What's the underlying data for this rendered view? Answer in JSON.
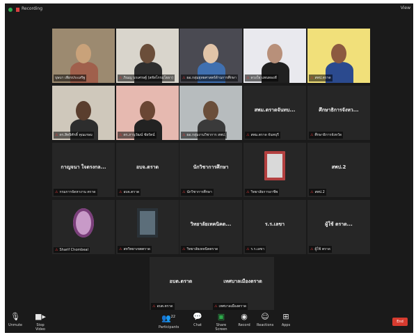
{
  "topbar": {
    "recording_label": "Recording",
    "view_label": "View"
  },
  "participants": [
    {
      "label": "บุษบา เพียรประเสริฐ",
      "bigname": "",
      "video": true,
      "muted": false,
      "active": true
    },
    {
      "label": "ภิณญ นรเศรษฐ์ (สหัสโกรมโยธา)",
      "bigname": "",
      "video": true,
      "muted": true,
      "active": false
    },
    {
      "label": "ผอ.กลุ่มยุทธศาสตร์ด้านการศึกษา",
      "bigname": "",
      "video": true,
      "muted": true,
      "active": false
    },
    {
      "label": "ดวงใจ แพนทองดี",
      "bigname": "",
      "video": true,
      "muted": true,
      "active": false
    },
    {
      "label": "สพป.ตราด",
      "bigname": "",
      "video": true,
      "muted": true,
      "active": false
    },
    {
      "label": "ดร.สิทธิศักดิ์ คุณเกษม",
      "bigname": "",
      "video": true,
      "muted": true,
      "active": false
    },
    {
      "label": "ดร.ภานุวัฒน์ ชัยรัตน์",
      "bigname": "",
      "video": true,
      "muted": true,
      "active": false
    },
    {
      "label": "ผอ.กลุ่มงานวิชาการ สพป.",
      "bigname": "",
      "video": true,
      "muted": true,
      "active": false
    },
    {
      "label": "สพม.ตราด จันทบุรี",
      "bigname": "สพม.ตราดจันทบ...",
      "video": false,
      "muted": true,
      "active": false
    },
    {
      "label": "ศึกษาธิการจังหวัด",
      "bigname": "ศึกษาธิการจังหว...",
      "video": false,
      "muted": true,
      "active": false
    },
    {
      "label": "กรมการจัดหางาน ตราด",
      "bigname": "กาญจนา ใจตรงกล...",
      "video": false,
      "muted": true,
      "active": false
    },
    {
      "label": "อบจ.ตราด",
      "bigname": "อบจ.ตราด",
      "video": false,
      "muted": true,
      "active": false
    },
    {
      "label": "นักวิชาการศึกษา",
      "bigname": "นักวิชาการศึกษา",
      "video": false,
      "muted": true,
      "active": false
    },
    {
      "label": "วิทยาลัยการอาชีพ",
      "bigname": "",
      "video": true,
      "muted": true,
      "active": false
    },
    {
      "label": "สพป.2",
      "bigname": "สพป.2",
      "video": false,
      "muted": true,
      "active": false
    },
    {
      "label": "Sharif Chombeal",
      "bigname": "",
      "video": true,
      "muted": true,
      "active": false
    },
    {
      "label": "สหวิทยาเขตตราด",
      "bigname": "",
      "video": true,
      "muted": true,
      "active": false
    },
    {
      "label": "วิทยาลัยเทคนิคตราด",
      "bigname": "วิทยาลัยเทคนิคต...",
      "video": false,
      "muted": true,
      "active": false
    },
    {
      "label": "ร.ร.เลขา",
      "bigname": "ร.ร.เลขา",
      "video": false,
      "muted": true,
      "active": false
    },
    {
      "label": "ผู้ใช้ ตราด",
      "bigname": "ผู้ใช้ ตราด...",
      "video": false,
      "muted": true,
      "active": false
    },
    {
      "label": "อบต.ตราด",
      "bigname": "อบต.ตราด",
      "video": false,
      "muted": true,
      "active": false
    },
    {
      "label": "เทศบาลเมืองตราด",
      "bigname": "เทศบาลเมืองตราด",
      "video": false,
      "muted": true,
      "active": false
    }
  ],
  "toolbar": {
    "unmute": {
      "label": "Unmute",
      "icon": "microphone-icon"
    },
    "start_video": {
      "label": "Stop Video",
      "icon": "video-camera-icon"
    },
    "participants": {
      "label": "Participants",
      "icon": "participants-icon",
      "count": "22"
    },
    "chat": {
      "label": "Chat",
      "icon": "chat-icon"
    },
    "share_screen": {
      "label": "Share Screen",
      "icon": "share-screen-icon",
      "color": "#2da94a"
    },
    "record": {
      "label": "Record",
      "icon": "record-icon"
    },
    "reactions": {
      "label": "Reactions",
      "icon": "reactions-icon"
    },
    "apps": {
      "label": "Apps",
      "icon": "apps-icon"
    },
    "end": {
      "label": "End",
      "color": "#d63b2f"
    }
  }
}
